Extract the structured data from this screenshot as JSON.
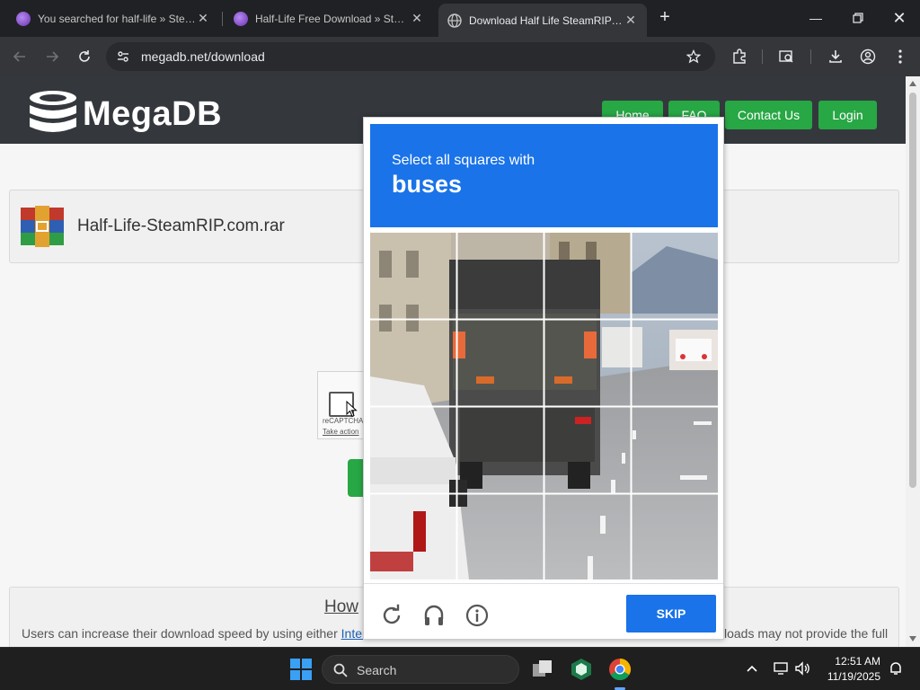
{
  "browser": {
    "tabs": [
      {
        "title": "You searched for half-life » SteamRIP",
        "active": false
      },
      {
        "title": "Half-Life Free Download » SteamRIP",
        "active": false
      },
      {
        "title": "Download Half Life SteamRIP com rar",
        "active": true
      }
    ],
    "url": "megadb.net/download"
  },
  "site": {
    "logo_text": "MegaDB",
    "nav": {
      "home": "Home",
      "faq": "FAQ",
      "contact": "Contact Us",
      "login": "Login"
    },
    "file_name": "Half-Life-SteamRIP.com.rar",
    "recaptcha_label": "reCAPTCHA",
    "recaptcha_action": "Take action",
    "info_heading": "How",
    "info_text_left": "Users can increase their download speed by using either",
    "info_link": "Intern",
    "info_text_right": "loads may not provide the full"
  },
  "captcha": {
    "instruction": "Select all squares with",
    "target": "buses",
    "skip_label": "SKIP",
    "colors": {
      "header": "#1a73e8",
      "skip": "#1a73e8"
    }
  },
  "taskbar": {
    "search_label": "Search",
    "time": "12:51 AM",
    "date": "11/19/2025"
  },
  "colors": {
    "accent_green": "#28a745",
    "site_header": "#34383d"
  }
}
